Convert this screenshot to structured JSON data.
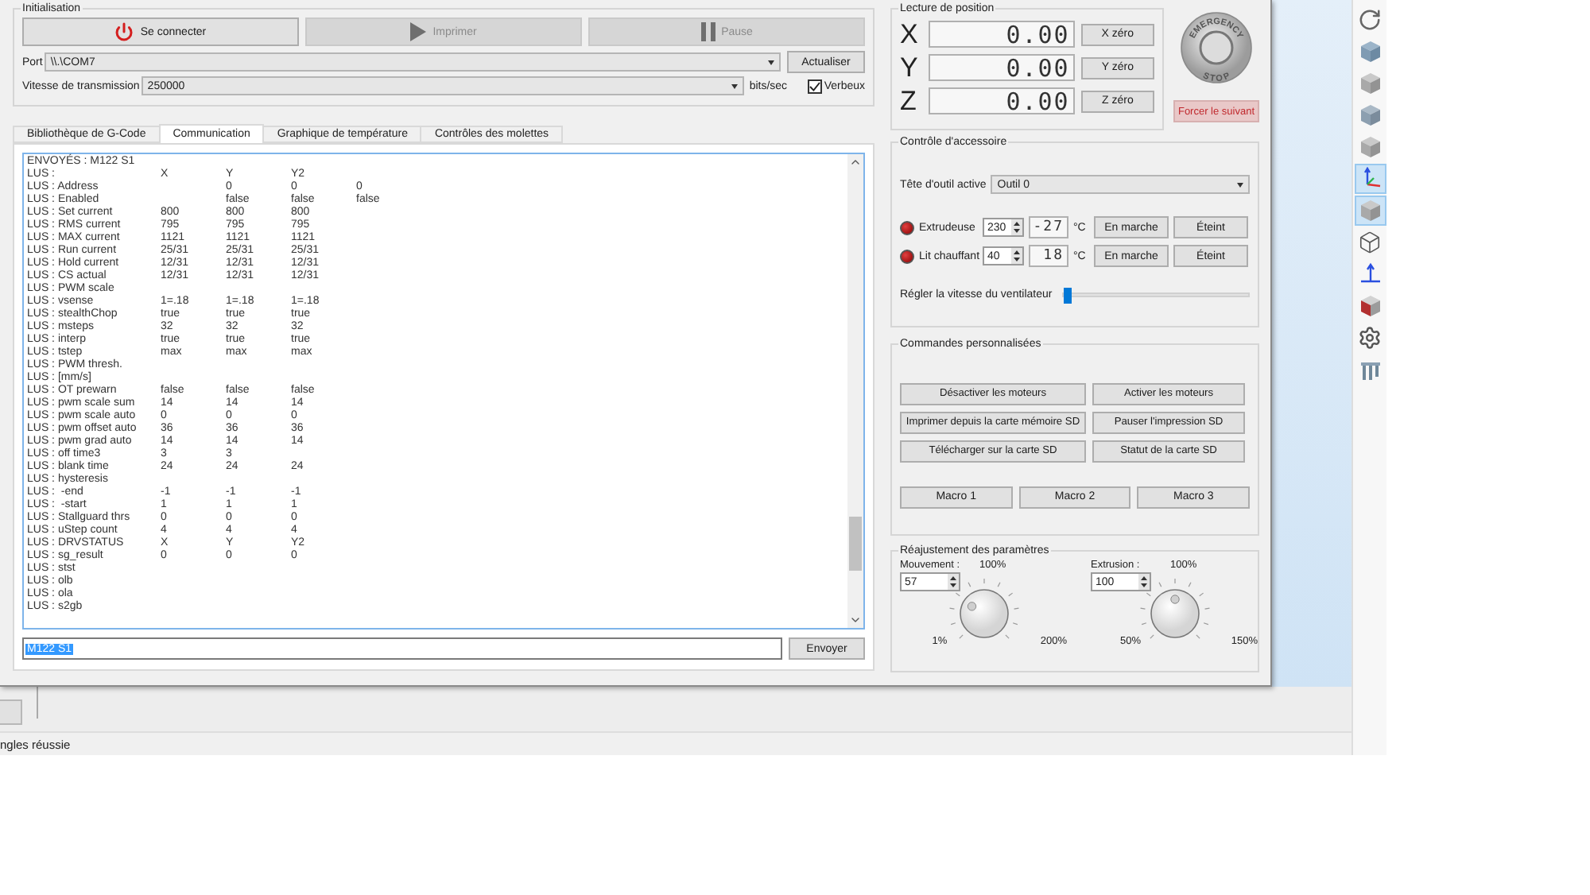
{
  "initialisation": {
    "title": "Initialisation",
    "buttons": [
      {
        "label": "Se connecter",
        "disabled": false
      },
      {
        "label": "Imprimer",
        "disabled": true
      },
      {
        "label": "Pause",
        "disabled": true
      }
    ],
    "port": {
      "label": "Port",
      "value": "\\\\.\\COM7",
      "button": "Actualiser"
    },
    "baud": {
      "label": "Vitesse de transmission",
      "value": "250000",
      "unit": "bits/sec"
    },
    "verbose": {
      "label": "Verbeux",
      "checked": true
    }
  },
  "tabs": [
    {
      "label": "Bibliothèque de G-Code",
      "selected": false
    },
    {
      "label": "Communication",
      "selected": true
    },
    {
      "label": "Graphique de température",
      "selected": false
    },
    {
      "label": "Contrôles des molettes",
      "selected": false
    }
  ],
  "log": {
    "sent": "ENVOYÉS : M122 S1",
    "lines": [
      {
        "label": "LUS :",
        "cells": [
          "X",
          "Y",
          "Y2"
        ]
      },
      {
        "label": "LUS : Address",
        "cells": [
          null,
          "0",
          "0",
          "0"
        ]
      },
      {
        "label": "LUS : Enabled",
        "cells": [
          null,
          "false",
          "false",
          "false"
        ]
      },
      {
        "label": "LUS : Set current",
        "cells": [
          "800",
          "800",
          "800"
        ]
      },
      {
        "label": "LUS : RMS current",
        "cells": [
          "795",
          "795",
          "795"
        ]
      },
      {
        "label": "LUS : MAX current",
        "cells": [
          "1121",
          "1121",
          "1121"
        ]
      },
      {
        "label": "LUS : Run current",
        "cells": [
          "25/31",
          "25/31",
          "25/31"
        ]
      },
      {
        "label": "LUS : Hold current",
        "cells": [
          "12/31",
          "12/31",
          "12/31"
        ]
      },
      {
        "label": "LUS : CS actual",
        "cells": [
          "12/31",
          "12/31",
          "12/31"
        ]
      },
      {
        "label": "LUS : PWM scale"
      },
      {
        "label": "LUS : vsense",
        "cells": [
          "1=.18",
          "1=.18",
          "1=.18"
        ]
      },
      {
        "label": "LUS : stealthChop",
        "cells": [
          "true",
          "true",
          "true"
        ]
      },
      {
        "label": "LUS : msteps",
        "cells": [
          "32",
          "32",
          "32"
        ]
      },
      {
        "label": "LUS : interp",
        "cells": [
          "true",
          "true",
          "true"
        ]
      },
      {
        "label": "LUS : tstep",
        "cells": [
          "max",
          "max",
          "max"
        ]
      },
      {
        "label": "LUS : PWM thresh."
      },
      {
        "label": "LUS : [mm/s]"
      },
      {
        "label": "LUS : OT prewarn",
        "cells": [
          "false",
          "false",
          "false"
        ]
      },
      {
        "label": "LUS : pwm scale sum",
        "cells": [
          "14",
          "14",
          "14"
        ]
      },
      {
        "label": "LUS : pwm scale auto",
        "cells": [
          "0",
          "0",
          "0"
        ]
      },
      {
        "label": "LUS : pwm offset auto",
        "cells": [
          "36",
          "36",
          "36"
        ]
      },
      {
        "label": "LUS : pwm grad auto",
        "cells": [
          "14",
          "14",
          "14"
        ]
      },
      {
        "label": "LUS : off time3",
        "cells": [
          "3",
          "3"
        ]
      },
      {
        "label": "LUS : blank time",
        "cells": [
          "24",
          "24",
          "24"
        ]
      },
      {
        "label": "LUS : hysteresis"
      },
      {
        "label": "LUS :  -end",
        "cells": [
          "-1",
          "-1",
          "-1"
        ]
      },
      {
        "label": "LUS :  -start",
        "cells": [
          "1",
          "1",
          "1"
        ]
      },
      {
        "label": "LUS : Stallguard thrs",
        "cells": [
          "0",
          "0",
          "0"
        ]
      },
      {
        "label": "LUS : uStep count",
        "cells": [
          "4",
          "4",
          "4"
        ]
      },
      {
        "label": "LUS : DRVSTATUS",
        "cells": [
          "X",
          "Y",
          "Y2"
        ]
      },
      {
        "label": "LUS : sg_result",
        "cells": [
          "0",
          "0",
          "0"
        ]
      },
      {
        "label": "LUS : stst"
      },
      {
        "label": "LUS : olb"
      },
      {
        "label": "LUS : ola"
      },
      {
        "label": "LUS : s2gb"
      }
    ]
  },
  "command": {
    "value": "M122 S1",
    "button": "Envoyer"
  },
  "position": {
    "title": "Lecture de position",
    "axes": [
      {
        "axis": "X",
        "value": "0.00",
        "button": "X zéro"
      },
      {
        "axis": "Y",
        "value": "0.00",
        "button": "Y zéro"
      },
      {
        "axis": "Z",
        "value": "0.00",
        "button": "Z zéro"
      }
    ]
  },
  "emergency_stop": {
    "top": "EMERGENCY",
    "bottom": "STOP"
  },
  "force_next": "Forcer le suivant",
  "accessory": {
    "title": "Contrôle d'accessoire",
    "tool_label": "Tête d'outil active",
    "tool_value": "Outil 0",
    "heaters": [
      {
        "label": "Extrudeuse",
        "target": "230",
        "reading": "-27",
        "unit": "°C",
        "on_button": "En marche",
        "off_button": "Éteint"
      },
      {
        "label": "Lit chauffant",
        "target": "40",
        "reading": "18",
        "unit": "°C",
        "on_button": "En marche",
        "off_button": "Éteint"
      }
    ],
    "fan": {
      "label": "Régler la vitesse du ventilateur",
      "level": 0
    }
  },
  "custom_commands": {
    "title": "Commandes personnalisées",
    "buttons": [
      "Désactiver les moteurs",
      "Activer les moteurs",
      "Imprimer depuis la carte mémoire SD",
      "Pauser l'impression SD",
      "Télécharger sur la carte SD",
      "Statut de la carte SD"
    ],
    "macros": [
      "Macro 1",
      "Macro 2",
      "Macro 3"
    ]
  },
  "adjustments": {
    "title": "Réajustement des paramètres",
    "dials": [
      {
        "label": "Mouvement :",
        "center": "100%",
        "value": "57",
        "min": "1%",
        "max": "200%",
        "level": 0.28
      },
      {
        "label": "Extrusion :",
        "center": "100%",
        "value": "100",
        "min": "50%",
        "max": "150%",
        "level": 0.5
      }
    ]
  },
  "view_toolbar": [
    {
      "selected": false
    },
    {
      "selected": false
    },
    {
      "selected": false
    },
    {
      "selected": false
    },
    {
      "selected": false
    },
    {
      "selected": true
    },
    {
      "selected": true
    },
    {
      "selected": false
    },
    {
      "selected": false
    },
    {
      "selected": false
    },
    {
      "selected": false
    },
    {
      "selected": false
    }
  ],
  "status_bar": {
    "text": "ngles réussie"
  }
}
